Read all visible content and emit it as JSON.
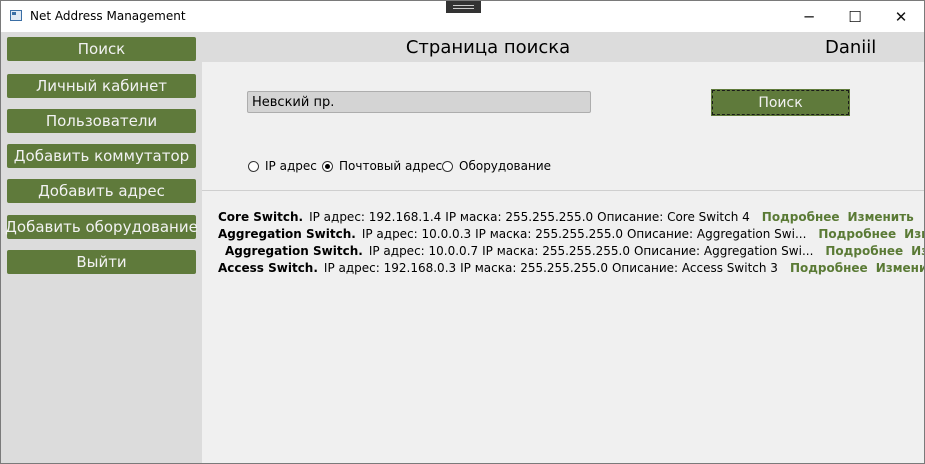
{
  "window": {
    "title": "Net Address Management",
    "minimize_glyph": "─",
    "maximize_glyph": "☐",
    "close_glyph": "✕"
  },
  "sidebar": {
    "items": [
      {
        "label": "Поиск"
      },
      {
        "label": "Личный кабинет"
      },
      {
        "label": "Пользователи"
      },
      {
        "label": "Добавить коммутатор"
      },
      {
        "label": "Добавить адрес"
      },
      {
        "label": "Добавить оборудование"
      },
      {
        "label": "Выйти"
      }
    ]
  },
  "header": {
    "title": "Страница поиска",
    "user": "Daniil"
  },
  "search": {
    "value": "Невский пр.",
    "button_label": "Поиск"
  },
  "filters": {
    "options": [
      {
        "label": "IP адрес",
        "checked": false
      },
      {
        "label": "Почтовый адрес",
        "checked": true
      },
      {
        "label": "Оборудование",
        "checked": false
      }
    ]
  },
  "results": [
    {
      "name": "Core Switch.",
      "ip": "IP адрес: 192.168.1.4",
      "mask": "IP маска: 255.255.255.0",
      "description": "Описание: Core Switch 4",
      "details": "Подробнее",
      "edit": "Изменить"
    },
    {
      "name": "Aggregation Switch.",
      "ip": "IP адрес: 10.0.0.3",
      "mask": "IP маска: 255.255.255.0",
      "description": "Описание: Aggregation Swi...",
      "details": "Подробнее",
      "edit": "Изменить"
    },
    {
      "name": "Aggregation Switch.",
      "ip": "IP адрес: 10.0.0.7",
      "mask": "IP маска: 255.255.255.0",
      "description": "Описание: Aggregation Swi...",
      "details": "Подробнее",
      "edit": "Изменить"
    },
    {
      "name": "Access Switch.",
      "ip": "IP адрес: 192.168.0.3",
      "mask": "IP маска: 255.255.255.0",
      "description": "Описание: Access Switch 3",
      "details": "Подробнее",
      "edit": "Изменить"
    }
  ],
  "colors": {
    "accent": "#5f7a3b",
    "link": "#5a7a35",
    "sidebar_bg": "#dcdcdc"
  }
}
